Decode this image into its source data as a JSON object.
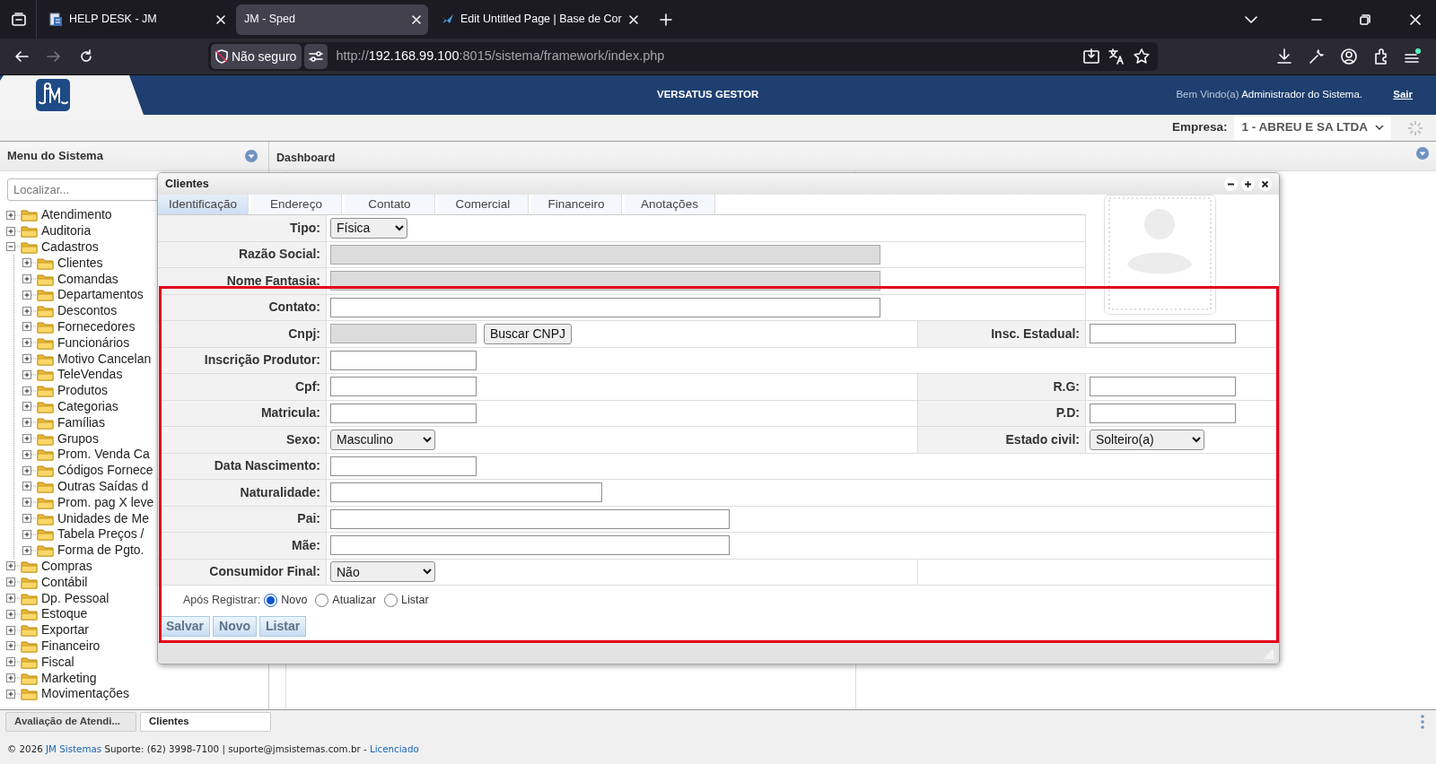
{
  "browser": {
    "tabs": [
      {
        "title": "HELP DESK - JM",
        "selected": false
      },
      {
        "title": "JM - Sped",
        "selected": true
      },
      {
        "title": "Edit Untitled Page | Base de Cor",
        "selected": false
      }
    ],
    "security": "Não seguro",
    "url": {
      "scheme": "http://",
      "host": "192.168.99.100",
      "rest": ":8015/sistema/framework/index.php"
    }
  },
  "app": {
    "title": "VERSATUS GESTOR",
    "greeting": "Bem Vindo(a)",
    "user": "Administrador do Sistema.",
    "logout": "Sair",
    "company_label": "Empresa:",
    "company": "1 - ABREU E SA LTDA"
  },
  "sidebar": {
    "title": "Menu do Sistema",
    "search_placeholder": "Localizar...",
    "items": [
      {
        "label": "Atendimento",
        "expanded": false
      },
      {
        "label": "Auditoria",
        "expanded": false
      },
      {
        "label": "Cadastros",
        "expanded": true,
        "children": [
          {
            "label": "Clientes",
            "expanded": false
          },
          {
            "label": "Comandas",
            "expanded": false
          },
          {
            "label": "Departamentos",
            "expanded": false
          },
          {
            "label": "Descontos",
            "expanded": false
          },
          {
            "label": "Fornecedores",
            "expanded": false
          },
          {
            "label": "Funcionários",
            "expanded": false
          },
          {
            "label": "Motivo Cancelan",
            "expanded": false
          },
          {
            "label": "TeleVendas",
            "expanded": false
          },
          {
            "label": "Produtos",
            "expanded": false
          },
          {
            "label": "Categorias",
            "expanded": false
          },
          {
            "label": "Famílias",
            "expanded": false
          },
          {
            "label": "Grupos",
            "expanded": false
          },
          {
            "label": "Prom. Venda Ca",
            "expanded": false
          },
          {
            "label": "Códigos Fornece",
            "expanded": false
          },
          {
            "label": "Outras Saídas d",
            "expanded": false
          },
          {
            "label": "Prom. pag X leve",
            "expanded": false
          },
          {
            "label": "Unidades de Me",
            "expanded": false
          },
          {
            "label": "Tabela Preços /",
            "expanded": false
          },
          {
            "label": "Forma de Pgto.",
            "expanded": false
          }
        ]
      },
      {
        "label": "Compras",
        "expanded": false
      },
      {
        "label": "Contábil",
        "expanded": false
      },
      {
        "label": "Dp. Pessoal",
        "expanded": false
      },
      {
        "label": "Estoque",
        "expanded": false
      },
      {
        "label": "Exportar",
        "expanded": false
      },
      {
        "label": "Financeiro",
        "expanded": false
      },
      {
        "label": "Fiscal",
        "expanded": false
      },
      {
        "label": "Marketing",
        "expanded": false
      },
      {
        "label": "Movimentações",
        "expanded": false
      }
    ]
  },
  "dashboard": {
    "title": "Dashboard"
  },
  "dialog": {
    "title": "Clientes",
    "tabs": [
      {
        "label": "Identificação",
        "selected": true
      },
      {
        "label": "Endereço",
        "selected": false
      },
      {
        "label": "Contato",
        "selected": false
      },
      {
        "label": "Comercial",
        "selected": false
      },
      {
        "label": "Financeiro",
        "selected": false
      },
      {
        "label": "Anotações",
        "selected": false
      }
    ],
    "rows": [
      {
        "label": "Tipo:",
        "field": {
          "kind": "select",
          "value": "Física"
        }
      },
      {
        "label": "Razão Social:",
        "field": {
          "kind": "text",
          "disabled": true
        }
      },
      {
        "label": "Nome Fantasia:",
        "field": {
          "kind": "text",
          "disabled": true
        }
      },
      {
        "label": "Contato:",
        "field": {
          "kind": "text",
          "disabled": false
        }
      },
      {
        "label": "Cnpj:",
        "field": {
          "kind": "text",
          "disabled": true,
          "button": "Buscar CNPJ"
        },
        "right": {
          "label": "Insc. Estadual:",
          "field": {
            "kind": "text",
            "disabled": false
          }
        }
      },
      {
        "label": "Inscrição Produtor:",
        "field": {
          "kind": "text",
          "disabled": false
        }
      },
      {
        "label": "Cpf:",
        "field": {
          "kind": "text",
          "disabled": false
        },
        "right": {
          "label": "R.G:",
          "field": {
            "kind": "text",
            "disabled": false
          }
        }
      },
      {
        "label": "Matricula:",
        "field": {
          "kind": "text",
          "disabled": false
        },
        "right": {
          "label": "P.D:",
          "field": {
            "kind": "text",
            "disabled": false
          }
        }
      },
      {
        "label": "Sexo:",
        "field": {
          "kind": "select",
          "value": "Masculino"
        },
        "right": {
          "label": "Estado civil:",
          "field": {
            "kind": "select",
            "value": "Solteiro(a)"
          }
        }
      },
      {
        "label": "Data Nascimento:",
        "field": {
          "kind": "text",
          "disabled": false
        }
      },
      {
        "label": "Naturalidade:",
        "field": {
          "kind": "text",
          "disabled": false
        }
      },
      {
        "label": "Pai:",
        "field": {
          "kind": "text",
          "disabled": false
        }
      },
      {
        "label": "Mãe:",
        "field": {
          "kind": "text",
          "disabled": false
        }
      },
      {
        "label": "Consumidor Final:",
        "field": {
          "kind": "select",
          "value": "Não"
        }
      }
    ],
    "after_register": {
      "label": "Após Registrar:",
      "options": [
        {
          "label": "Novo",
          "selected": true
        },
        {
          "label": "Atualizar",
          "selected": false
        },
        {
          "label": "Listar",
          "selected": false
        }
      ]
    },
    "buttons": [
      "Salvar",
      "Novo",
      "Listar"
    ]
  },
  "taskbar": {
    "tabs": [
      {
        "label": "Avaliação de Atendi...",
        "selected": false
      },
      {
        "label": "Clientes",
        "selected": true
      }
    ]
  },
  "footer": {
    "parts": [
      {
        "kind": "text",
        "text": "© 2026 "
      },
      {
        "kind": "link",
        "text": "JM Sistemas"
      },
      {
        "kind": "text",
        "text": " Suporte: (62) 3998-7100 | suporte@jmsistemas.com.br - "
      },
      {
        "kind": "link",
        "text": "Licenciado"
      }
    ]
  }
}
